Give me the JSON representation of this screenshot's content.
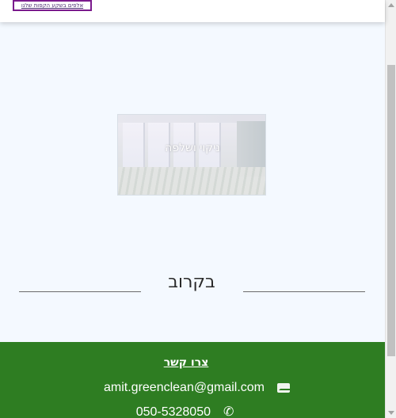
{
  "header": {
    "focused_link_text": "אלפים בשקע הקפות שלנו"
  },
  "hero": {
    "title": "ניקוי ושלפה"
  },
  "soon": {
    "title": "בקרוב"
  },
  "footer": {
    "contact_title": "צרו קשר",
    "email": "amit.greenclean@gmail.com",
    "phone": "050-5328050",
    "background_color": "#2e7d22"
  },
  "icons": {
    "email": "envelope-icon",
    "phone": "phone-icon"
  }
}
